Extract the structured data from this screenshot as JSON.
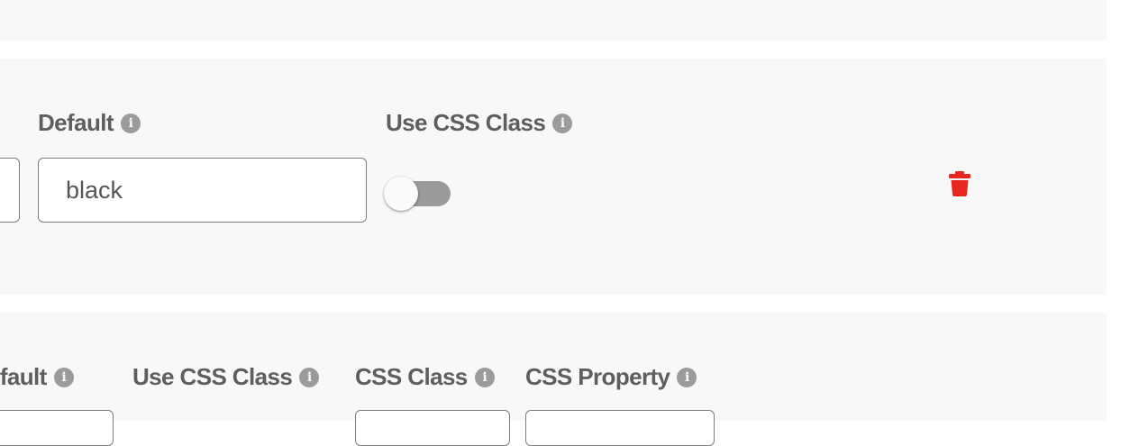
{
  "row_mid": {
    "default_label": "Default",
    "default_value": "black",
    "use_css_class_label": "Use CSS Class",
    "use_css_class_enabled": false
  },
  "row_bottom": {
    "default_label": "efault",
    "use_css_class_label": "Use CSS Class",
    "css_class_label": "CSS Class",
    "css_property_label": "CSS Property"
  },
  "icons": {
    "info": "info-circle-icon",
    "delete": "trash-icon"
  },
  "colors": {
    "panel_bg": "#f8f8f8",
    "label_text": "#5e5e5e",
    "info_icon": "#9b9b9b",
    "delete_icon": "#e8281e",
    "toggle_track_off": "#9a9a9a"
  }
}
